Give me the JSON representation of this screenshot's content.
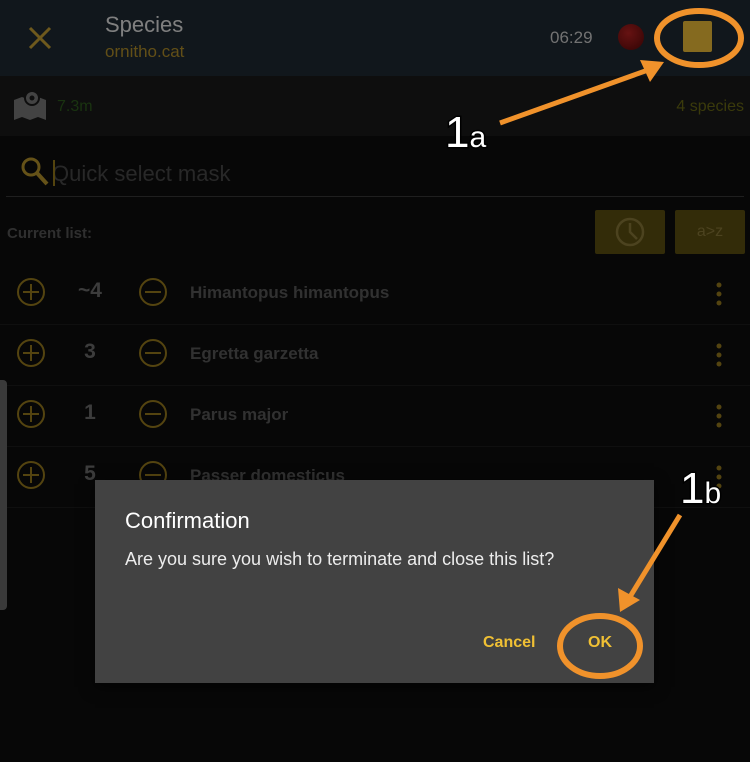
{
  "appbar": {
    "title": "Species",
    "subtitle": "ornitho.cat",
    "time": "06:29"
  },
  "location": {
    "accuracy": "7.3m",
    "species_count": "4 species"
  },
  "search": {
    "placeholder": "Quick select mask"
  },
  "list": {
    "label": "Current list:",
    "sort_az_label": "a>z",
    "rows": [
      {
        "count": "~4",
        "name": "Himantopus himantopus"
      },
      {
        "count": "3",
        "name": "Egretta garzetta"
      },
      {
        "count": "1",
        "name": "Parus major"
      },
      {
        "count": "5",
        "name": "Passer domesticus"
      }
    ]
  },
  "dialog": {
    "title": "Confirmation",
    "message": "Are you sure you wish to terminate and close this list?",
    "cancel": "Cancel",
    "ok": "OK"
  },
  "annotations": {
    "a_num": "1",
    "a_letter": "a",
    "b_num": "1",
    "b_letter": "b",
    "color": "#f0922b"
  },
  "colors": {
    "accent": "#f2c23a",
    "appbar": "#1f2a33",
    "dialog": "#424242"
  }
}
